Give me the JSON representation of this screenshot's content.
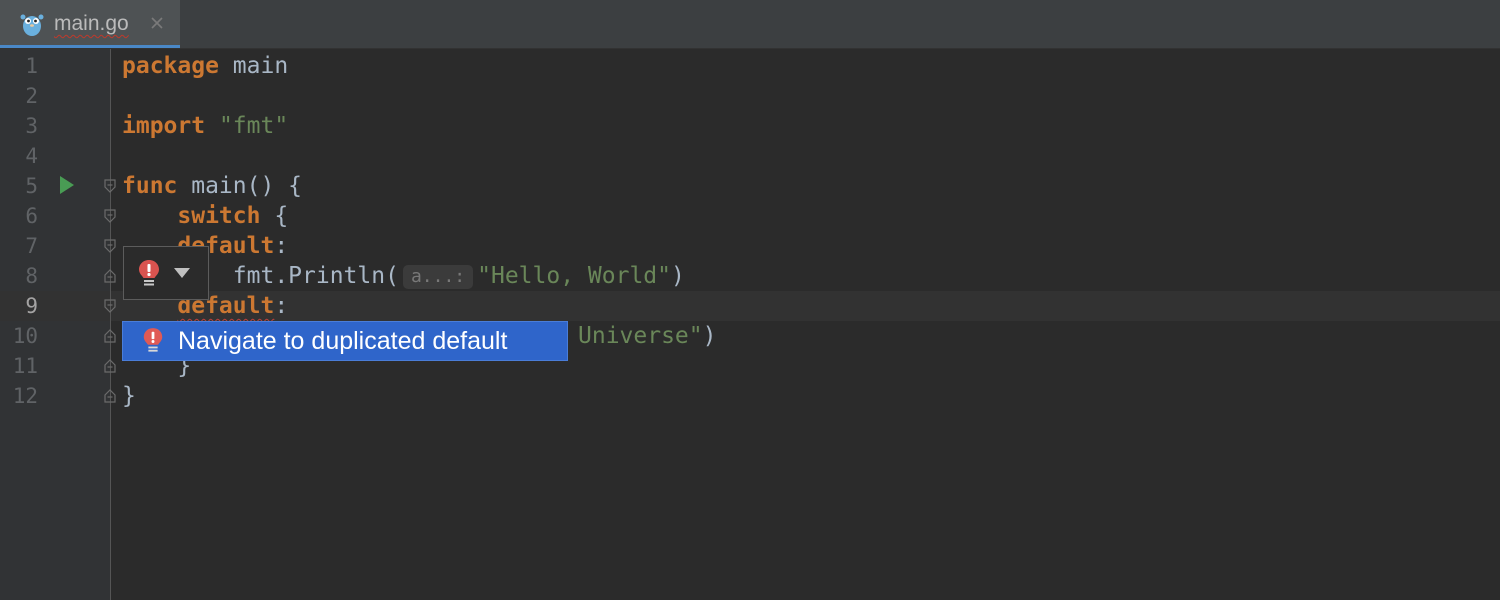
{
  "tab": {
    "filename": "main.go",
    "icon": "gopher-icon",
    "close_icon": "close-icon"
  },
  "gutter": {
    "line_numbers": [
      "1",
      "2",
      "3",
      "4",
      "5",
      "6",
      "7",
      "8",
      "9",
      "10",
      "11",
      "12"
    ],
    "current_line": "9"
  },
  "code": {
    "l1_kw": "package",
    "l1_rest": " main",
    "l3_kw": "import",
    "l3_str": "\"fmt\"",
    "l5_kw": "func",
    "l5_rest": " main() {",
    "l6_kw": "switch",
    "l6_rest": " {",
    "l7_kw": "default",
    "l7_rest": ":",
    "l8_call": "fmt.Println(",
    "l8_hint": "a...:",
    "l8_str": "\"Hello, World\"",
    "l8_end": ")",
    "l9_kw": "default",
    "l9_rest": ":",
    "l10_str": "Universe\"",
    "l10_end": ")",
    "l11": "}",
    "l12": "}"
  },
  "intention": {
    "icon": "error-bulb-icon",
    "dropdown": "chevron-down-icon"
  },
  "popup": {
    "label": "Navigate to duplicated default",
    "icon": "error-bulb-icon"
  },
  "colors": {
    "keyword": "#cc7832",
    "string": "#6a8759",
    "text": "#a9b7c6",
    "selection": "#2f65ca",
    "error": "#c0392b"
  }
}
